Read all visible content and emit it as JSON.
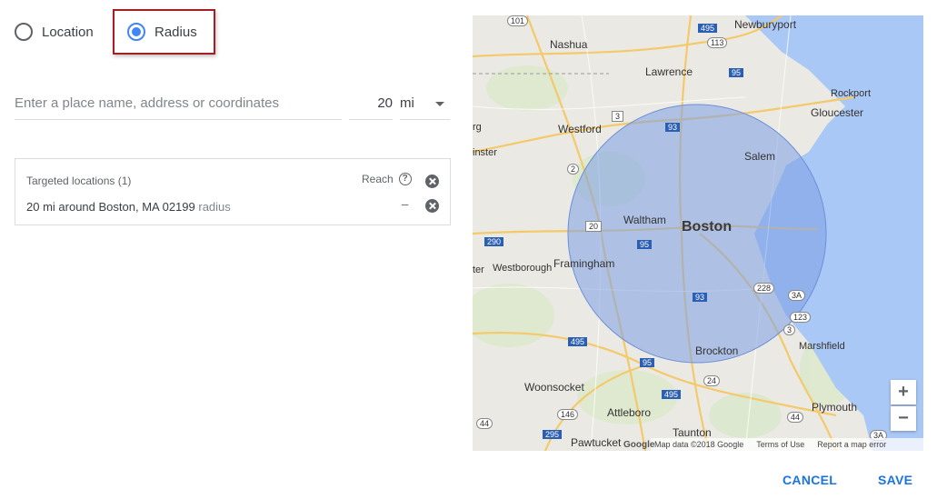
{
  "radio": {
    "location_label": "Location",
    "radius_label": "Radius",
    "selected": "Radius"
  },
  "search": {
    "placeholder": "Enter a place name, address or coordinates",
    "radius_value": "20",
    "unit": "mi"
  },
  "targeted": {
    "title": "Targeted locations (1)",
    "reach_label": "Reach",
    "items": [
      {
        "name": "20 mi around Boston, MA 02199",
        "type": "radius",
        "reach": "–"
      }
    ]
  },
  "map": {
    "city_labels": [
      "Nashua",
      "Newburyport",
      "Lawrence",
      "Rockport",
      "Westford",
      "Gloucester",
      "Salem",
      "Waltham",
      "Boston",
      "Framingham",
      "Westborough",
      "Marshfield",
      "Brockton",
      "Woonsocket",
      "Plymouth",
      "Attleboro",
      "Taunton",
      "Pawtucket"
    ],
    "edge_labels": [
      "rg",
      "inster",
      "ter"
    ],
    "route_labels": [
      "101",
      "495",
      "113",
      "95",
      "3",
      "93",
      "2",
      "20",
      "290",
      "95",
      "228",
      "3A",
      "123",
      "3",
      "93",
      "495",
      "95",
      "24",
      "495",
      "146",
      "44",
      "295",
      "44",
      "3A"
    ],
    "footer": {
      "logo": "Google",
      "copyright": "Map data ©2018 Google",
      "terms": "Terms of Use",
      "report": "Report a map error"
    },
    "zoom_in": "+",
    "zoom_out": "−",
    "water_color": "#aac8f5",
    "radius_fill_color": "#7b9ee6"
  },
  "actions": {
    "cancel": "CANCEL",
    "save": "SAVE"
  },
  "colors": {
    "accent": "#4285f4",
    "button_text": "#1a73e8",
    "highlight_border": "#a31f24"
  }
}
